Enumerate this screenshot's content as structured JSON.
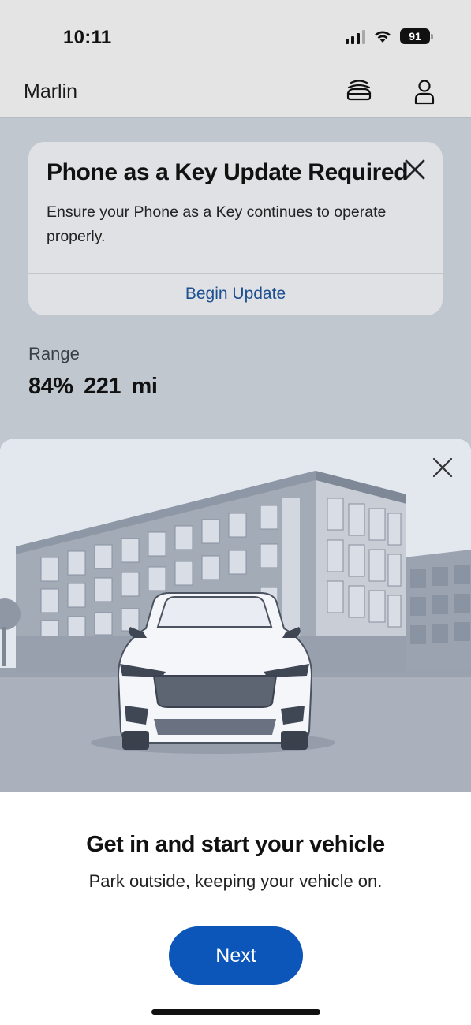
{
  "status_bar": {
    "time": "10:11",
    "battery": "91"
  },
  "header": {
    "title": "Marlin",
    "vehicle_icon": "vehicles-icon",
    "account_icon": "person-icon"
  },
  "banner": {
    "title": "Phone as a Key Update Required",
    "body": "Ensure your Phone as a Key continues to operate properly.",
    "action": "Begin Update"
  },
  "range": {
    "label": "Range",
    "percent": "84%",
    "distance": "221 mi"
  },
  "sheet": {
    "heading": "Get in and start your vehicle",
    "subtext": "Park outside, keeping your vehicle on.",
    "button": "Next"
  },
  "colors": {
    "accent": "#0b56b8",
    "link": "#1d4f91",
    "dim_background": "#c0c7cf"
  }
}
